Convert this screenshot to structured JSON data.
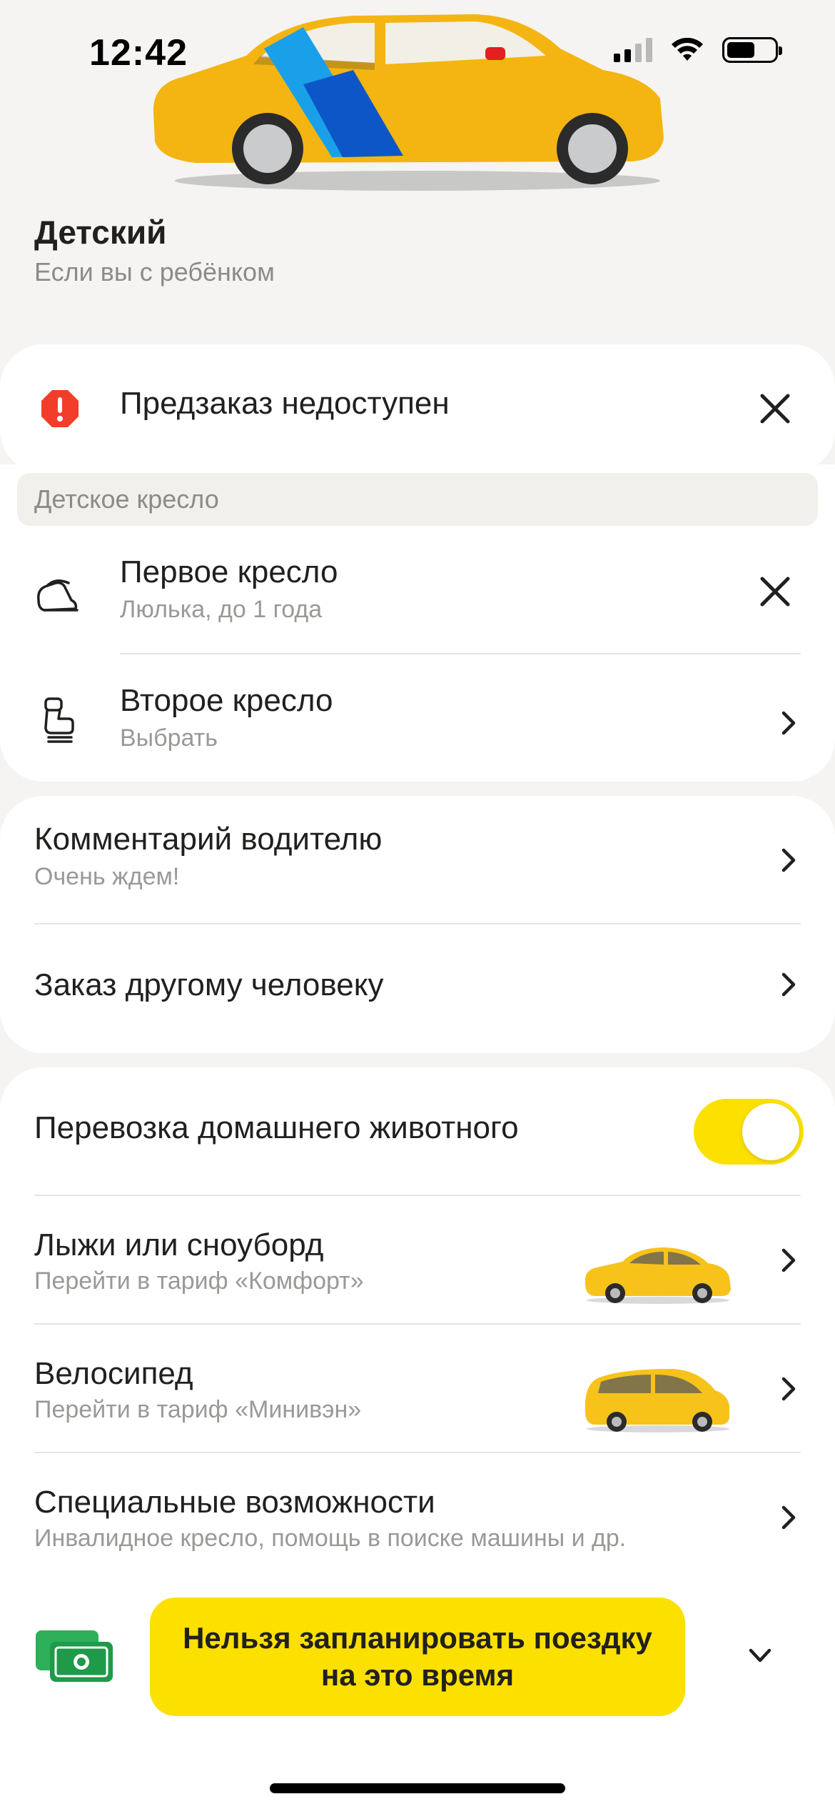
{
  "status_bar": {
    "time": "12:42"
  },
  "header": {
    "title": "Детский",
    "subtitle": "Если вы с ребёнком"
  },
  "alert": {
    "text": "Предзаказ недоступен",
    "icon": "warning-octagon-icon",
    "color": "#f33d2b"
  },
  "child_seat_section": {
    "header": "Детское кресло",
    "items": [
      {
        "title": "Первое кресло",
        "subtitle": "Люлька, до 1 года",
        "icon": "infant-carrier-icon",
        "action": "close-icon"
      },
      {
        "title": "Второе кресло",
        "subtitle": "Выбрать",
        "icon": "child-seat-icon",
        "action": "chevron-right-icon"
      }
    ]
  },
  "driver_section": {
    "items": [
      {
        "title": "Комментарий водителю",
        "subtitle": "Очень ждем!"
      },
      {
        "title": "Заказ другому человеку"
      }
    ]
  },
  "options_section": {
    "items": [
      {
        "title": "Перевозка домашнего животного",
        "toggle_on": true
      },
      {
        "title": "Лыжи или сноуборд",
        "subtitle": "Перейти в тариф «Комфорт»",
        "image": "sedan-car-icon"
      },
      {
        "title": "Велосипед",
        "subtitle": "Перейти в тариф «Минивэн»",
        "image": "minivan-car-icon"
      },
      {
        "title": "Специальные возможности",
        "subtitle": "Инвалидное кресло, помощь в поиске машины и др."
      }
    ]
  },
  "bottom": {
    "payment_icon": "cash-icon",
    "cta": "Нельзя запланировать поездку на это время",
    "expand_icon": "chevron-down-icon"
  },
  "colors": {
    "accent": "#fce000",
    "alert": "#f33d2b",
    "background": "#f5f4f2",
    "card": "#ffffff"
  }
}
